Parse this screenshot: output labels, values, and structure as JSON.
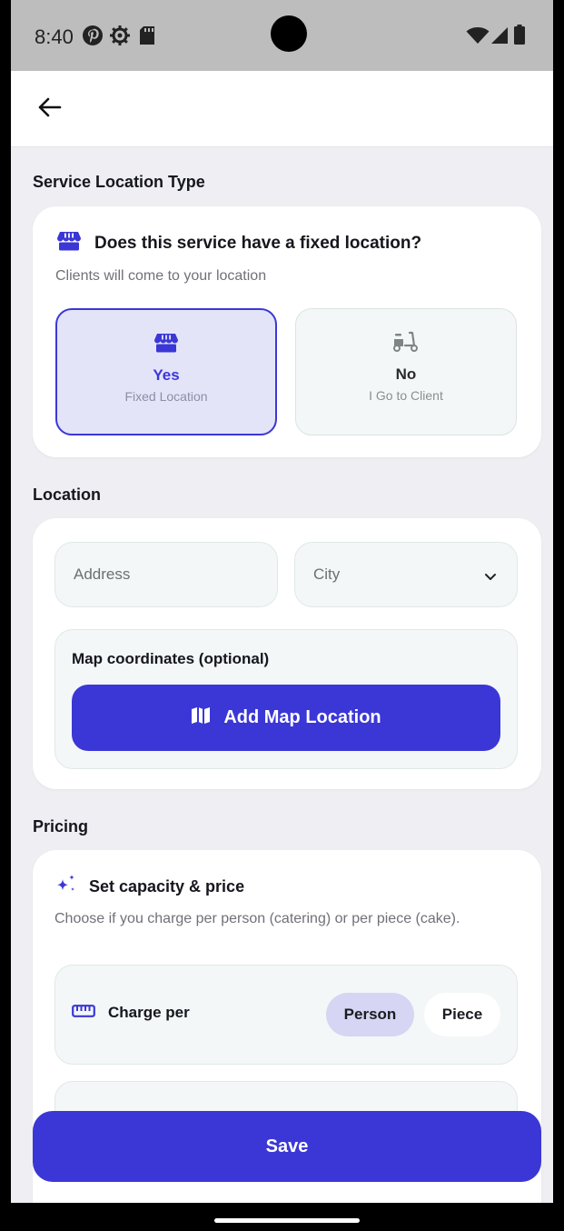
{
  "status_bar": {
    "time": "8:40",
    "icons_left": [
      "pinterest-icon",
      "settings-icon",
      "sd-card-icon"
    ],
    "icons_right": [
      "wifi-icon",
      "signal-icon",
      "battery-icon"
    ]
  },
  "app_bar": {
    "back_icon": "arrow-left-icon"
  },
  "service_location": {
    "section_title": "Service Location Type",
    "question": "Does this service have a fixed location?",
    "subtitle": "Clients will come to your location",
    "options": [
      {
        "label": "Yes",
        "sub": "Fixed Location",
        "icon": "store-icon",
        "selected": true
      },
      {
        "label": "No",
        "sub": "I Go to Client",
        "icon": "scooter-icon",
        "selected": false
      }
    ]
  },
  "location": {
    "section_title": "Location",
    "address_placeholder": "Address",
    "city_placeholder": "City",
    "map_label": "Map coordinates (optional)",
    "map_button": "Add Map Location"
  },
  "pricing": {
    "section_title": "Pricing",
    "card_title": "Set capacity & price",
    "description": "Choose if you charge per person (catering) or per piece (cake).",
    "charge_label": "Charge per",
    "options": [
      {
        "label": "Person",
        "active": true
      },
      {
        "label": "Piece",
        "active": false
      }
    ]
  },
  "save_button": "Save",
  "colors": {
    "primary": "#3B37D6",
    "selected_bg": "#E4E4F9",
    "pill_active": "#D6D5F3",
    "page_bg": "#EFEFF3"
  }
}
